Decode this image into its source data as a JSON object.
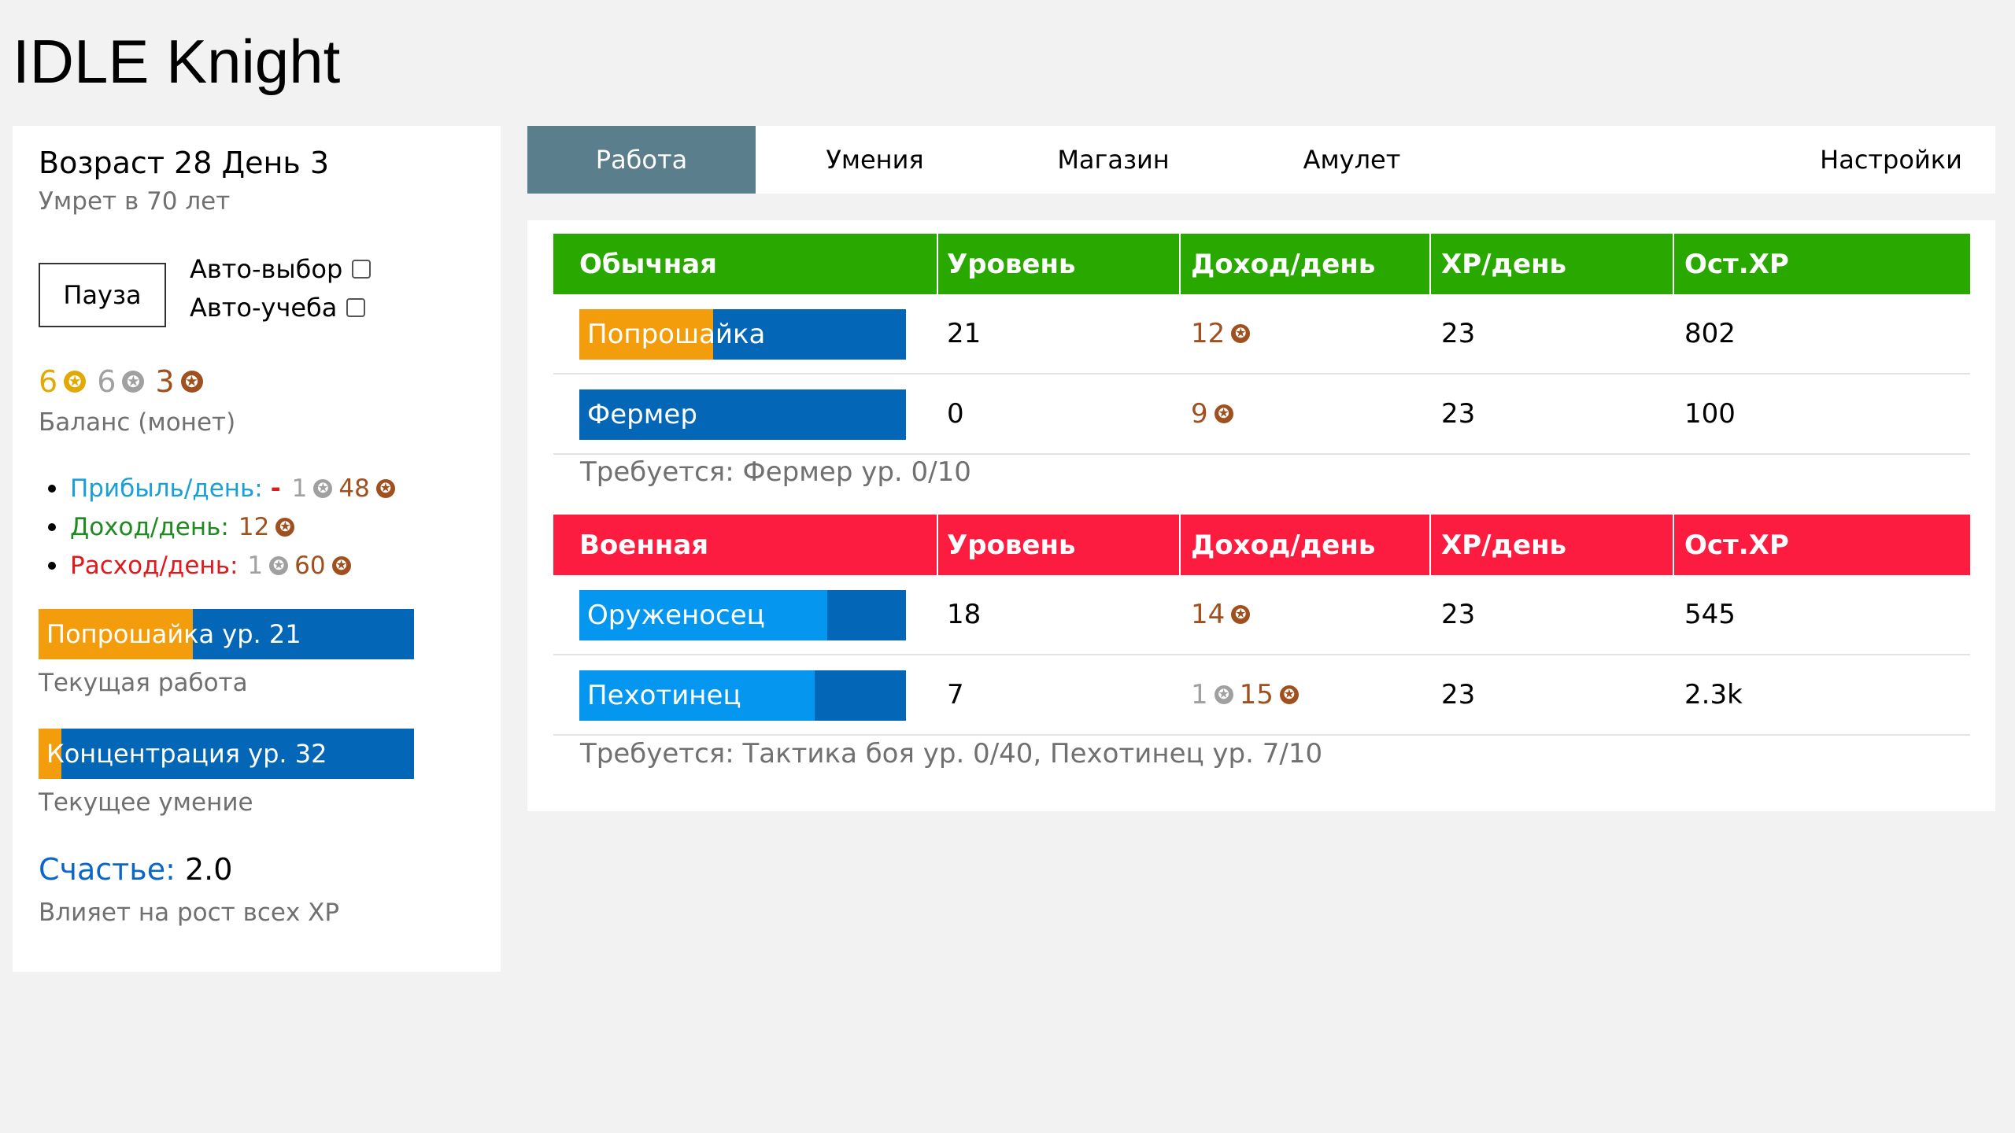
{
  "app_title": "IDLE Knight",
  "sidebar": {
    "age_text": "Возраст 28 День 3",
    "death_text": "Умрет в 70 лет",
    "pause_label": "Пауза",
    "auto_choose_label": "Авто-выбор",
    "auto_choose_checked": false,
    "auto_study_label": "Авто-учеба",
    "auto_study_checked": false,
    "balance": {
      "gold": "6",
      "silver": "6",
      "copper": "3",
      "label": "Баланс (монет)"
    },
    "profit": {
      "label": "Прибыль/день:",
      "sign": "-",
      "silver": "1",
      "copper": "48"
    },
    "income": {
      "label": "Доход/день:",
      "copper": "12"
    },
    "expense": {
      "label": "Расход/день:",
      "silver": "1",
      "copper": "60"
    },
    "current_job": {
      "label": "Попрошайка ур. 21",
      "progress": 0.41,
      "caption": "Текущая работа"
    },
    "current_skill": {
      "label": "Концентрация ур. 32",
      "progress": 0.06,
      "caption": "Текущее умение"
    },
    "happiness": {
      "label": "Счастье:",
      "value": "2.0",
      "caption": "Влияет на рост всех XP"
    }
  },
  "tabs": [
    {
      "label": "Работа",
      "active": true
    },
    {
      "label": "Умения",
      "active": false
    },
    {
      "label": "Магазин",
      "active": false
    },
    {
      "label": "Амулет",
      "active": false
    },
    {
      "label": "Настройки",
      "active": false
    }
  ],
  "columns": {
    "level": "Уровень",
    "income": "Доход/день",
    "xp": "XP/день",
    "xp_left": "Ост.XP"
  },
  "categories": [
    {
      "name": "Обычная",
      "color": "#29a800",
      "jobs": [
        {
          "name": "Попрошайка",
          "level": "21",
          "income_copper": "12",
          "xp": "23",
          "xp_left": "802",
          "progress": 0.41,
          "fill": "orange"
        },
        {
          "name": "Фермер",
          "level": "0",
          "income_copper": "9",
          "xp": "23",
          "xp_left": "100",
          "progress": 0.0,
          "fill": "orange"
        }
      ],
      "requirement": "Требуется: Фермер ур. 0/10"
    },
    {
      "name": "Военная",
      "color": "#fc1c40",
      "jobs": [
        {
          "name": "Оруженосец",
          "level": "18",
          "income_copper": "14",
          "xp": "23",
          "xp_left": "545",
          "progress": 0.76,
          "fill": "lblue"
        },
        {
          "name": "Пехотинец",
          "level": "7",
          "income_silver": "1",
          "income_copper": "15",
          "xp": "23",
          "xp_left": "2.3k",
          "progress": 0.72,
          "fill": "lblue"
        }
      ],
      "requirement": "Требуется: Тактика боя ур. 0/40, Пехотинец ур. 7/10"
    }
  ]
}
